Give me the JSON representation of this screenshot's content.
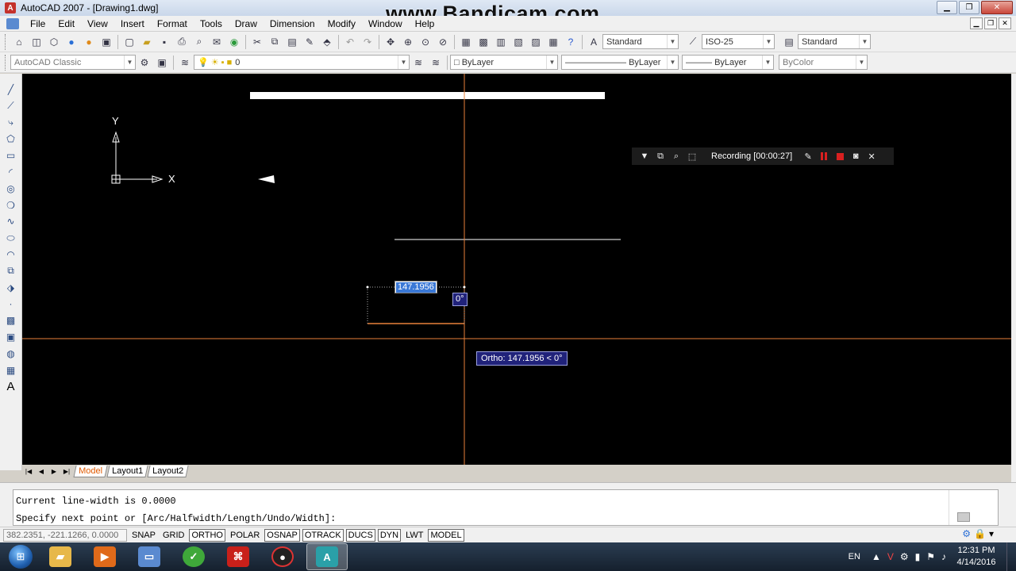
{
  "window": {
    "title": "AutoCAD 2007 - [Drawing1.dwg]",
    "watermark": "www.Bandicam.com",
    "app_icon_letter": "A",
    "minimize": "▁",
    "restore": "❐",
    "close": "✕"
  },
  "menubar": {
    "items": [
      "File",
      "Edit",
      "View",
      "Insert",
      "Format",
      "Tools",
      "Draw",
      "Dimension",
      "Modify",
      "Window",
      "Help"
    ],
    "mdi": [
      "▁",
      "❐",
      "✕"
    ]
  },
  "toolbar1": {
    "text_style": "Standard",
    "dim_style": "ISO-25",
    "table_style": "Standard"
  },
  "toolbar2": {
    "workspace": "AutoCAD Classic",
    "layer": "0",
    "color": "ByLayer",
    "linetype": "ByLayer",
    "lineweight": "ByLayer",
    "plotstyle": "ByColor"
  },
  "canvas": {
    "ucs_y": "Y",
    "ucs_x": "X",
    "dyn_value": "147.1956",
    "angle_value": "0°",
    "tooltip": "Ortho: 147.1956 < 0°"
  },
  "recording": {
    "text": "Recording [00:00:27]"
  },
  "tabs": {
    "items": [
      "Model",
      "Layout1",
      "Layout2"
    ]
  },
  "command": {
    "line1": "Current line-width is 0.0000",
    "line2": "Specify next point or [Arc/Halfwidth/Length/Undo/Width]:"
  },
  "status": {
    "coords": "382.2351, -221.1266, 0.0000",
    "toggles": [
      {
        "label": "SNAP",
        "on": false
      },
      {
        "label": "GRID",
        "on": false
      },
      {
        "label": "ORTHO",
        "on": true
      },
      {
        "label": "POLAR",
        "on": false
      },
      {
        "label": "OSNAP",
        "on": true
      },
      {
        "label": "OTRACK",
        "on": true
      },
      {
        "label": "DUCS",
        "on": true
      },
      {
        "label": "DYN",
        "on": true
      },
      {
        "label": "LWT",
        "on": false
      },
      {
        "label": "MODEL",
        "on": true
      }
    ]
  },
  "taskbar": {
    "language": "EN",
    "time": "12:31 PM",
    "date": "4/14/2016"
  },
  "colors": {
    "canvas_bg": "#000000",
    "crosshair": "#e8813a",
    "tooltip_bg": "#20227a",
    "dyn_highlight": "#3a78d6"
  }
}
